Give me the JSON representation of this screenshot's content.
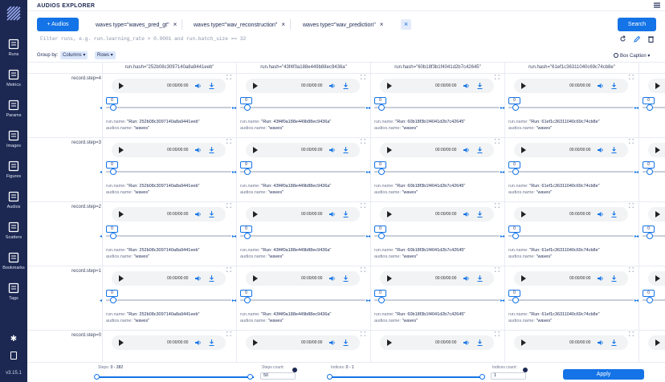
{
  "app": {
    "title": "AUDIOS EXPLORER",
    "version": "v3.15.1"
  },
  "sidebar": {
    "items": [
      {
        "label": "Runs",
        "icon": "runs-icon"
      },
      {
        "label": "Metrics",
        "icon": "metrics-icon"
      },
      {
        "label": "Params",
        "icon": "params-icon"
      },
      {
        "label": "Images",
        "icon": "images-icon"
      },
      {
        "label": "Figures",
        "icon": "figures-icon"
      },
      {
        "label": "Audios",
        "icon": "audios-icon"
      },
      {
        "label": "Scatters",
        "icon": "scatters-icon"
      },
      {
        "label": "Bookmarks",
        "icon": "bookmarks-icon"
      },
      {
        "label": "Tags",
        "icon": "tags-icon"
      }
    ]
  },
  "toolbar": {
    "add_label": "+ Audios",
    "search_label": "Search",
    "chips": [
      "waves type=\"waves_pred_gt\"",
      "waves type=\"wav_reconstruction\"",
      "waves type=\"wav_prediction\""
    ],
    "chip_close": "×",
    "clear_all": "×",
    "filter_placeholder": "Filter runs, e.g. run.learning_rate > 0.0001 and run.batch_size == 32"
  },
  "grouping": {
    "label": "Group by:",
    "columns_label": "Columns ▾",
    "rows_label": "Rows ▾",
    "box_caption": "Box Caption ▾"
  },
  "columns": [
    "run.hash=\"252b08c3097140a8a9441eeb\"",
    "run.hash=\"43f4f0a188e449b88ec9436a\"",
    "run.hash=\"60b18f3b1f4041d2b7c42645\"",
    "run.hash=\"61ef1c36311040c69c74cb8e\""
  ],
  "rows": [
    "record.step=4",
    "record.step=3",
    "record.step=2",
    "record.step=1",
    "record.step=0"
  ],
  "cell_times": [
    [
      "00:00/00:00",
      "00:00/00:00",
      "00:00/00:00",
      "00:00/00:00"
    ],
    [
      "00:00/00:00",
      "00:00/00:00",
      "00:00/00:00",
      "00:00/00:00"
    ],
    [
      "00:00/00:00",
      "00:00/00:00",
      "00:00/00:00",
      "00:00/00:00"
    ],
    [
      "00:00/00:00",
      "00:00/00:00",
      "00:00/00:00",
      "00:00/00:00"
    ],
    [
      "00:00/00:00",
      "00:00/00:00",
      "00:00/00:00",
      "00:00/00:00"
    ]
  ],
  "cell": {
    "value": "0",
    "run_names": [
      "\"Run: 252b08c3097140a8a9441eeb\"",
      "\"Run: 43f4f0a188e449b88ec9436a\"",
      "\"Run: 60b18f3b1f4041d2b7c42645\"",
      "\"Run: 61ef1c36311040c69c74cb8e\""
    ],
    "run_name_key": "run.name:",
    "audio_name_key": "audios.name:",
    "audio_name_value": "\"waves\""
  },
  "bottom": {
    "steps_label": "Steps:",
    "steps_range": "0 - 382",
    "steps_count_label": "Steps count:",
    "steps_count": "50",
    "indices_label": "Indices:",
    "indices_range": "0 - 1",
    "indices_count_label": "Indices count:",
    "indices_count": "1",
    "apply_label": "Apply"
  },
  "colors": {
    "sidebar": "#1c2852",
    "accent": "#1473e6",
    "chip_bg": "#dbe6fb"
  }
}
